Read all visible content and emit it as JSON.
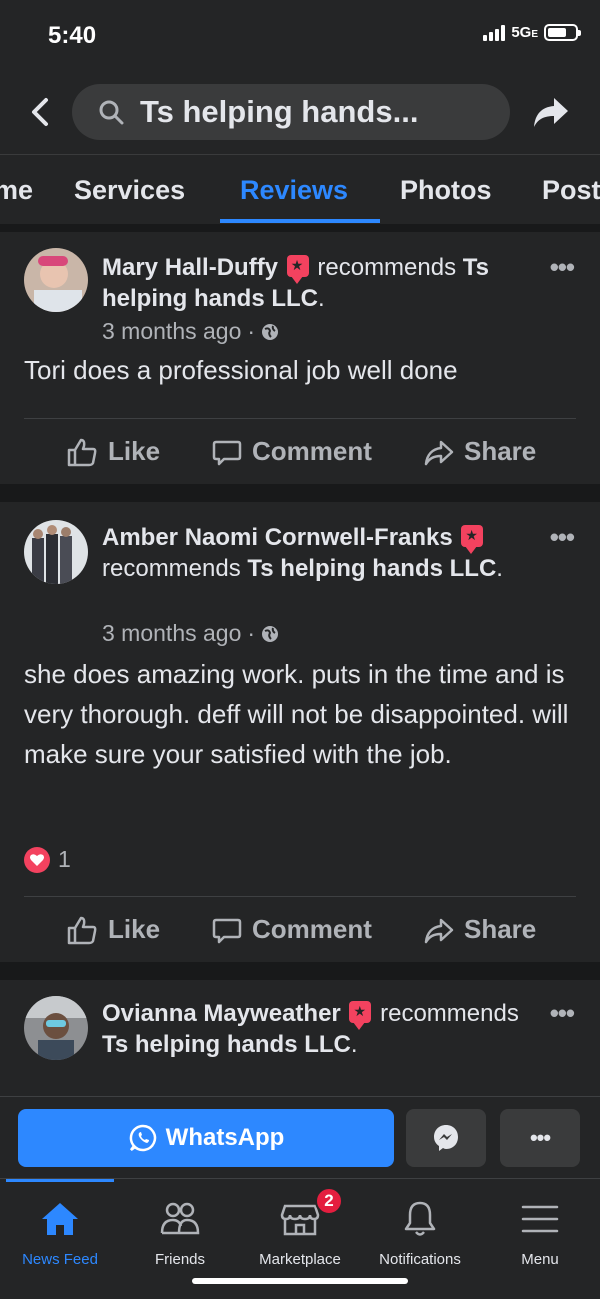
{
  "status_bar": {
    "time": "5:40",
    "network": "5G",
    "network_sub": "E"
  },
  "header": {
    "search_query": "Ts helping hands..."
  },
  "tabs": [
    {
      "label": "me"
    },
    {
      "label": "Services"
    },
    {
      "label": "Reviews"
    },
    {
      "label": "Photos"
    },
    {
      "label": "Post"
    }
  ],
  "reviews": [
    {
      "name": "Mary Hall-Duffy",
      "verb": "recommends",
      "page": "Ts helping hands LLC",
      "time": "3 months ago",
      "separator": "·",
      "text": "Tori does a professional job well done",
      "reactions": ""
    },
    {
      "name": "Amber Naomi Cornwell-Franks",
      "verb": "recommends",
      "page": "Ts helping hands LLC",
      "time": "3 months ago",
      "separator": "·",
      "text": "she does amazing work. puts in the time and is very thorough. deff will not be disappointed. will make sure your satisfied with the job.",
      "reactions": "1"
    },
    {
      "name": "Ovianna Mayweather",
      "verb": "recommends",
      "page": "Ts helping hands LLC"
    }
  ],
  "actions": {
    "like": "Like",
    "comment": "Comment",
    "share": "Share"
  },
  "whatsapp": {
    "label": "WhatsApp"
  },
  "nav": {
    "items": [
      {
        "label": "News Feed"
      },
      {
        "label": "Friends"
      },
      {
        "label": "Marketplace",
        "badge": "2"
      },
      {
        "label": "Notifications"
      },
      {
        "label": "Menu"
      }
    ]
  },
  "colors": {
    "accent": "#2d88ff",
    "background": "#18191a",
    "card": "#242526",
    "badge": "#f3425f"
  }
}
